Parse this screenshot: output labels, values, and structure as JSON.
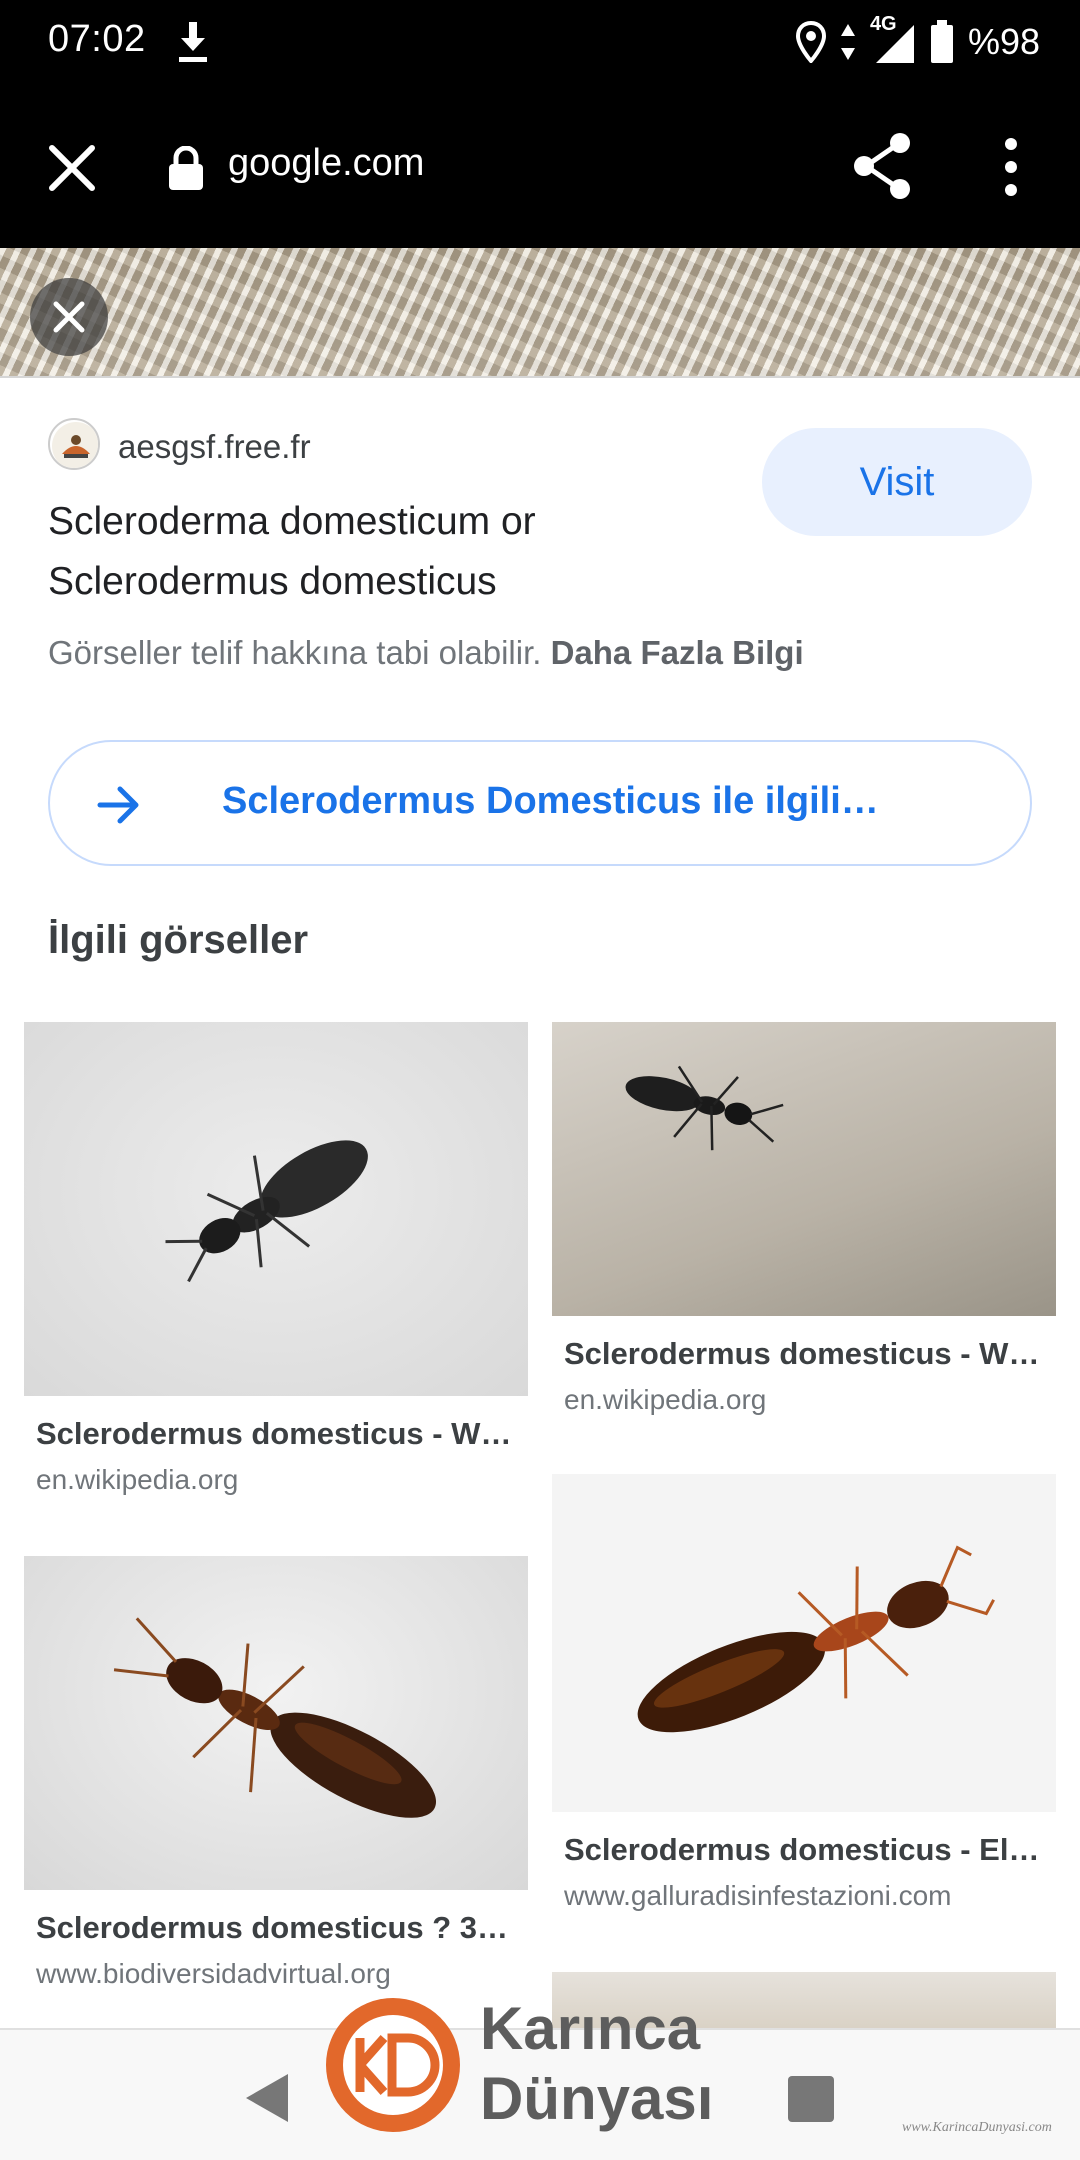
{
  "status_bar": {
    "time": "07:02",
    "network": "4G",
    "battery": "%98"
  },
  "browser": {
    "url": "google.com"
  },
  "source": {
    "domain": "aesgsf.free.fr",
    "title": "Scleroderma domesticum or Sclerodermus domesticus",
    "visit_label": "Visit",
    "copyright_text": "Görseller telif hakkına tabi olabilir.",
    "learn_more": "Daha Fazla Bilgi"
  },
  "related_search": {
    "label": "Sclerodermus Domesticus ile ilgili…"
  },
  "related_images": {
    "heading": "İlgili görseller",
    "items": [
      {
        "title": "Sclerodermus domesticus - W…",
        "source": "en.wikipedia.org"
      },
      {
        "title": "Sclerodermus domesticus - W…",
        "source": "en.wikipedia.org"
      },
      {
        "title": "Sclerodermus domesticus ? 3…",
        "source": "www.biodiversidadvirtual.org"
      },
      {
        "title": "Sclerodermus domesticus - El…",
        "source": "www.galluradisinfestazioni.com"
      }
    ]
  },
  "watermark": {
    "line1": "Karınca",
    "line2": "Dünyası",
    "small": "www.KarincaDunyasi.com"
  },
  "colors": {
    "accent": "#1a73e8",
    "visit_bg": "#e8f0fe",
    "toolbar_bg": "#000000",
    "watermark_orange": "#e2682b"
  }
}
